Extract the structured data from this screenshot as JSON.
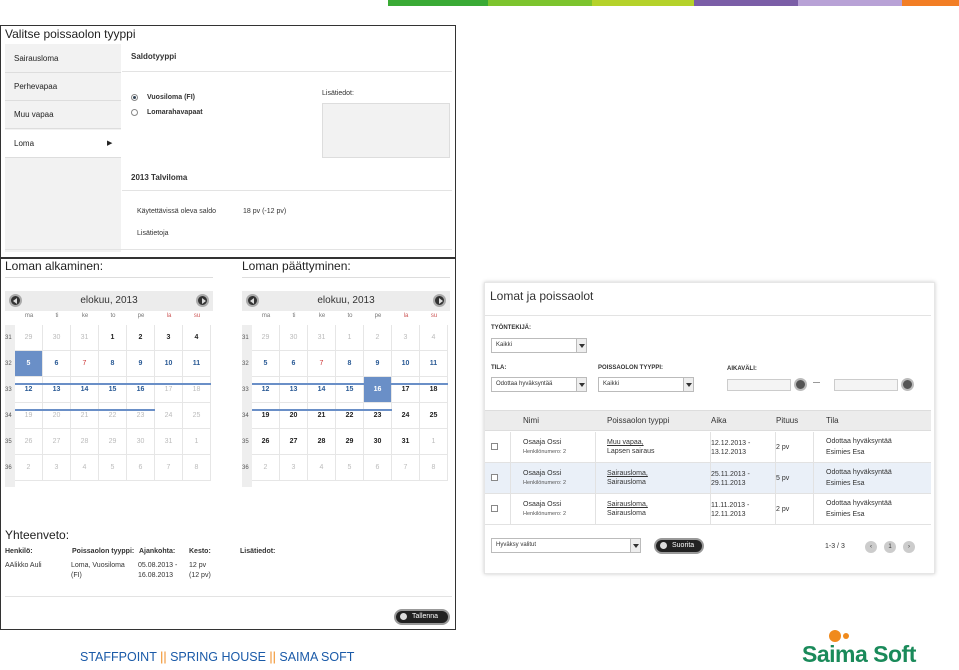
{
  "colors": {
    "bar": [
      "#1a8a3a",
      "#3aaa35",
      "#7dc42e",
      "#b5d22a",
      "#7b5ea7",
      "#b8a2d6",
      "#f27e25"
    ],
    "accent": "#6a8fc7",
    "footer_blue": "#1a5aa8",
    "brand_orange": "#f08a1c"
  },
  "left": {
    "title": "Valitse poissaolon tyyppi",
    "menu": [
      "Sairausloma",
      "Perhevapaa",
      "Muu vapaa",
      "Loma"
    ],
    "saldotyyppi": "Saldotyyppi",
    "radio1": "Vuosiloma (FI)",
    "radio2": "Lomarahavapaat",
    "lisatiedot_label": "Lisätiedot:",
    "section_title": "2013 Talviloma",
    "available_label": "Käytettävissä oleva saldo",
    "available_value": "18 pv   (-12 pv)",
    "lisatietoja": "Lisätietoja",
    "start_title": "Loman alkaminen:",
    "end_title": "Loman päättyminen:",
    "calendar": {
      "month": "elokuu, 2013",
      "dow": [
        "ma",
        "ti",
        "ke",
        "to",
        "pe",
        "la",
        "su"
      ],
      "weeks": [
        "31",
        "32",
        "33",
        "34",
        "35",
        "36"
      ],
      "days": [
        [
          "29",
          "30",
          "31",
          "1",
          "2",
          "3",
          "4"
        ],
        [
          "5",
          "6",
          "7",
          "8",
          "9",
          "10",
          "11"
        ],
        [
          "12",
          "13",
          "14",
          "15",
          "16",
          "17",
          "18"
        ],
        [
          "19",
          "20",
          "21",
          "22",
          "23",
          "24",
          "25"
        ],
        [
          "26",
          "27",
          "28",
          "29",
          "30",
          "31",
          "1"
        ],
        [
          "2",
          "3",
          "4",
          "5",
          "6",
          "7",
          "8"
        ]
      ]
    },
    "summary_title": "Yhteenveto:",
    "summary_headers": [
      "Henkilö:",
      "Poissaolon tyyppi:",
      "Ajankohta:",
      "Kesto:",
      "Lisätiedot:"
    ],
    "summary_person": "AAlikko Auli",
    "summary_type1": "Loma, Vuosiloma",
    "summary_type2": "(FI)",
    "summary_date1": "05.08.2013 -",
    "summary_date2": "16.08.2013",
    "summary_dur1": "12 pv",
    "summary_dur2": "(12 pv)",
    "save_label": "Tallenna"
  },
  "right": {
    "title": "Lomat ja poissaolot",
    "employee_label": "TYÖNTEKIJÄ:",
    "employee_value": "Kaikki",
    "state_label": "TILA:",
    "state_value": "Odottaa hyväksyntää",
    "type_label": "POISSAOLON TYYPPI:",
    "type_value": "Kaikki",
    "interval_label": "AIKAVÄLI:",
    "interval_dash": "—",
    "headers": [
      "Nimi",
      "Poissaolon tyyppi",
      "Aika",
      "Pituus",
      "Tila"
    ],
    "rows": [
      {
        "name": "Osaaja Ossi",
        "num": "Henkilönumero: 2",
        "type1": "Muu vapaa,",
        "type2": "Lapsen sairaus",
        "date1": "12.12.2013 -",
        "date2": "13.12.2013",
        "len": "2 pv",
        "state1": "Odottaa hyväksyntää",
        "state2": "Esimies Esa"
      },
      {
        "name": "Osaaja Ossi",
        "num": "Henkilönumero: 2",
        "type1": "Sairausloma,",
        "type2": "Sairausloma",
        "date1": "25.11.2013 -",
        "date2": "29.11.2013",
        "len": "5 pv",
        "state1": "Odottaa hyväksyntää",
        "state2": "Esimies Esa"
      },
      {
        "name": "Osaaja Ossi",
        "num": "Henkilönumero: 2",
        "type1": "Sairausloma,",
        "type2": "Sairausloma",
        "date1": "11.11.2013 -",
        "date2": "12.11.2013",
        "len": "2 pv",
        "state1": "Odottaa hyväksyntää",
        "state2": "Esimies Esa"
      }
    ],
    "action_value": "Hyväksy valitut",
    "run_label": "Suorita",
    "pager_info": "1-3 / 3",
    "page_num": "1"
  },
  "footer": {
    "left": "STAFFPOINT ",
    "sep1": "||",
    "mid": " SPRING HOUSE ",
    "sep2": "||",
    "right": " SAIMA SOFT",
    "logo": "Saima Soft"
  }
}
